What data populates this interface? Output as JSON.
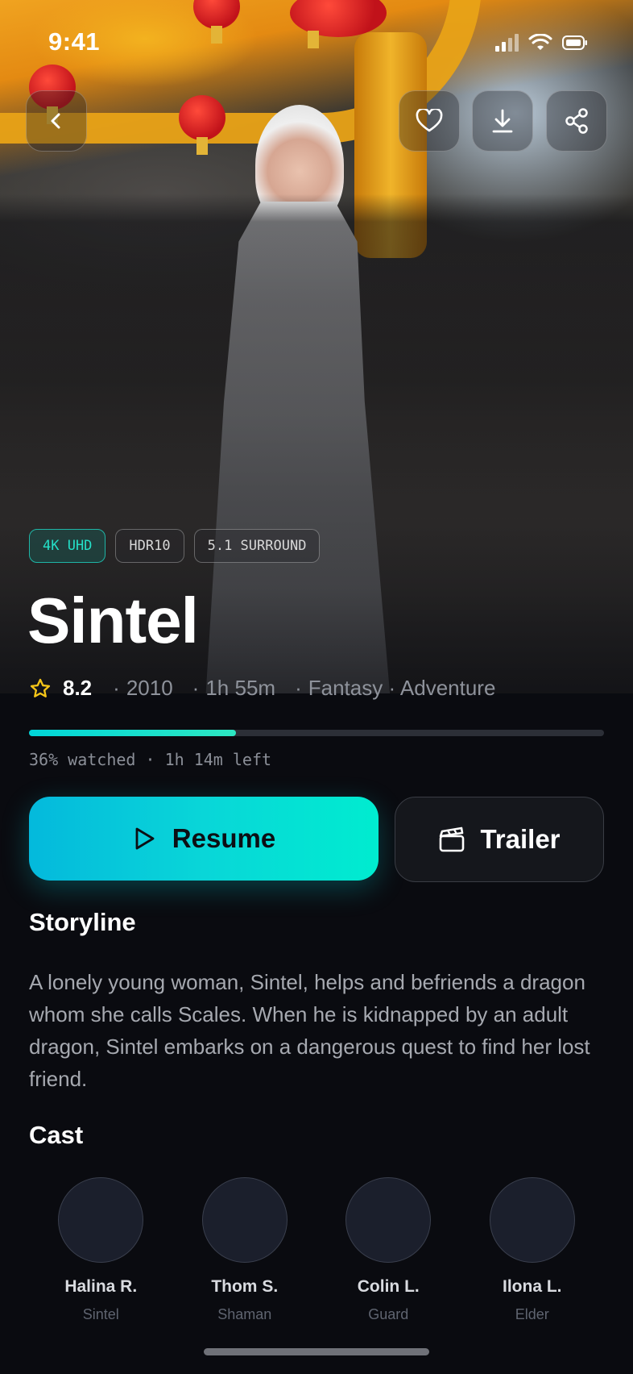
{
  "status": {
    "time": "9:41"
  },
  "badges": [
    "4K UHD",
    "HDR10",
    "5.1 SURROUND"
  ],
  "movie": {
    "title": "Sintel",
    "rating": "8.2",
    "year": "2010",
    "duration": "1h 55m",
    "genres": "Fantasy · Adventure"
  },
  "progress": {
    "fraction": 0.36,
    "label": "36% watched · 1h 14m left"
  },
  "actions": {
    "resume_label": "Resume",
    "trailer_label": "Trailer"
  },
  "storyline": {
    "heading": "Storyline",
    "text": "A lonely young woman, Sintel, helps and befriends a dragon whom she calls Scales. When he is kidnapped by an adult dragon, Sintel embarks on a dangerous quest to find her lost friend."
  },
  "cast": {
    "heading": "Cast",
    "members": [
      {
        "name": "Halina R.",
        "role": "Sintel"
      },
      {
        "name": "Thom S.",
        "role": "Shaman"
      },
      {
        "name": "Colin L.",
        "role": "Guard"
      },
      {
        "name": "Ilona L.",
        "role": "Elder"
      }
    ]
  },
  "colors": {
    "accent": "#00e0d0",
    "background": "#0a0b10",
    "star": "#f5c518"
  },
  "icons": [
    "back-icon",
    "heart-icon",
    "download-icon",
    "share-icon",
    "star-icon",
    "play-icon",
    "clapperboard-icon",
    "signal-icon",
    "wifi-icon",
    "battery-icon"
  ]
}
